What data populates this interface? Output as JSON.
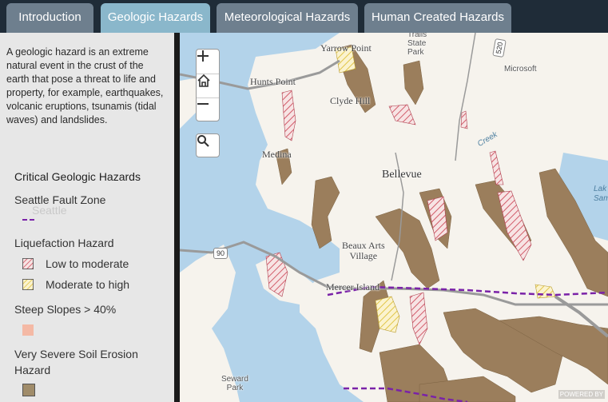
{
  "tabs": [
    {
      "label": "Introduction",
      "active": false
    },
    {
      "label": "Geologic Hazards",
      "active": true
    },
    {
      "label": "Meteorological Hazards",
      "active": false
    },
    {
      "label": "Human Created Hazards",
      "active": false
    }
  ],
  "panel": {
    "intro": "A geologic hazard is an extreme natural event in the crust of the earth that pose a threat to life and property, for example, earthquakes, volcanic eruptions, tsunamis (tidal waves) and landslides.",
    "legend_title": "Critical Geologic Hazards",
    "background_label": "Seattle",
    "seattle_fault": {
      "heading": "Seattle Fault Zone"
    },
    "liquefaction": {
      "heading": "Liquefaction Hazard",
      "items": [
        {
          "label": "Low to moderate",
          "color": "#e7808a"
        },
        {
          "label": "Moderate to high",
          "color": "#e9d36a"
        }
      ]
    },
    "steep_slopes": {
      "heading": "Steep Slopes > 40%",
      "color": "#f4b9a5"
    },
    "soil_erosion": {
      "heading": "Very Severe Soil Erosion Hazard",
      "color": "#a08c6a"
    }
  },
  "map": {
    "labels": {
      "clyde_hill": "Clyde Hill",
      "hunts_point": "Hunts Point",
      "yarrow_point": "Yarrow Point",
      "medina": "Medina",
      "bellevue": "Bellevue",
      "beaux_arts": "Beaux Arts\nVillage",
      "mercer_island": "Mercer Island",
      "seward_park": "Seward\nPark",
      "microsoft": "Microsoft",
      "bridle_trails": "Trails\nState\nPark",
      "lake_sammamish": "Lak\nSamm",
      "creek": "Creek"
    },
    "shields": {
      "i90": "90",
      "sr520": "520"
    },
    "powered_by": "POWERED BY"
  },
  "colors": {
    "fault": "#7a22a8",
    "water": "#b3d3ea",
    "land": "#f6f3ed",
    "erosion": "#9b7e5c"
  }
}
